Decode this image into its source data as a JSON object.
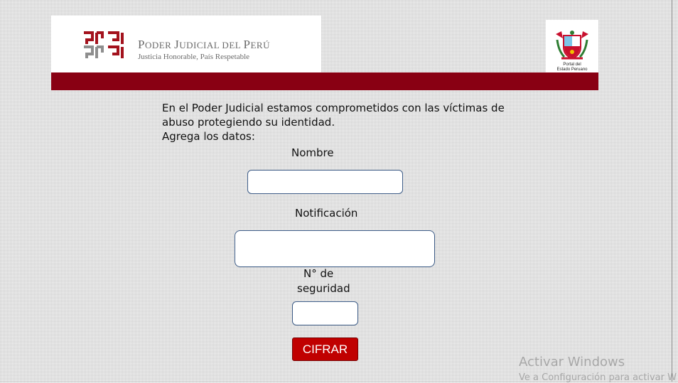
{
  "header": {
    "brand_title_initial_1": "P",
    "brand_title_rest_1": "ODER ",
    "brand_title_initial_2": "J",
    "brand_title_rest_2": "UDICIAL DEL ",
    "brand_title_initial_3": "P",
    "brand_title_rest_3": "ERÚ",
    "brand_subtitle": "Justicia Honorable, País Respetable",
    "portal_line1": "Portal del",
    "portal_line2": "Estado Peruano"
  },
  "colors": {
    "header_bar": "#890013",
    "button": "#c00000",
    "field_border": "#3c5b86"
  },
  "form": {
    "intro_line1": "En el Poder Judicial estamos comprometidos con las víctimas de",
    "intro_line2": "abuso protegiendo su identidad.",
    "intro_line3": "Agrega los datos:",
    "nombre_label": "Nombre",
    "nombre_value": "",
    "notificacion_label": "Notificación",
    "notificacion_value": "",
    "seguridad_label_line1": "N° de",
    "seguridad_label_line2": "seguridad",
    "seguridad_value": "",
    "submit_label": "CIFRAR"
  },
  "watermark": {
    "title": "Activar Windows",
    "subtitle": "Ve a Configuración para activar W"
  }
}
